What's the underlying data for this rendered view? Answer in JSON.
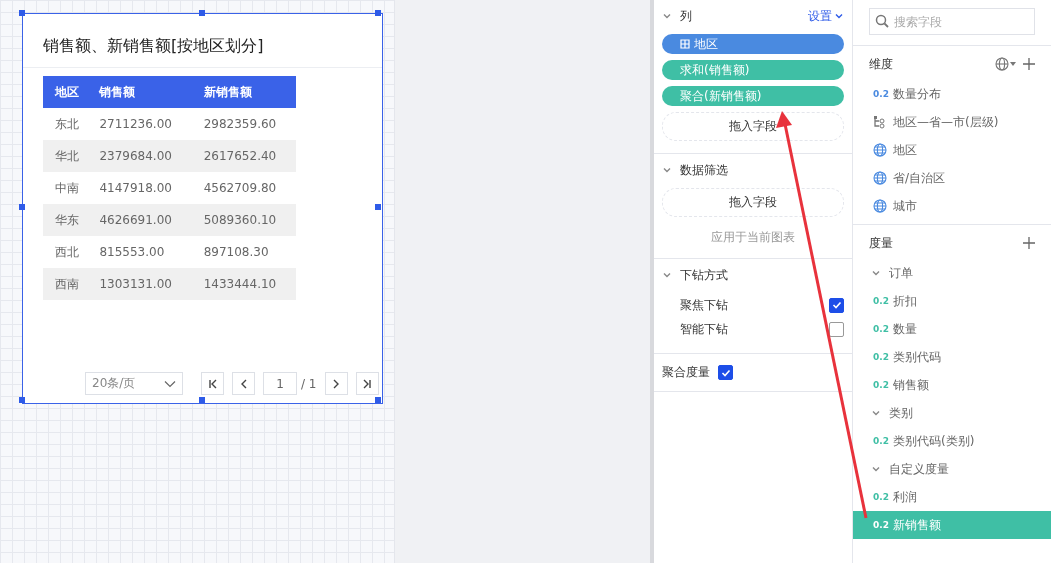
{
  "chart_card": {
    "title": "销售额、新销售额[按地区划分]",
    "table": {
      "columns": [
        "地区",
        "销售额",
        "新销售额"
      ],
      "rows": [
        [
          "东北",
          "2711236.00",
          "2982359.60"
        ],
        [
          "华北",
          "2379684.00",
          "2617652.40"
        ],
        [
          "中南",
          "4147918.00",
          "4562709.80"
        ],
        [
          "华东",
          "4626691.00",
          "5089360.10"
        ],
        [
          "西北",
          "815553.00",
          "897108.30"
        ],
        [
          "西南",
          "1303131.00",
          "1433444.10"
        ]
      ]
    },
    "pagination": {
      "page_size": "20条/页",
      "page": "1",
      "total": "/ 1"
    }
  },
  "config_panel": {
    "columns_section": {
      "title": "列",
      "action": "设置",
      "fields": [
        {
          "label": "地区",
          "kind": "dimension"
        },
        {
          "label": "求和(销售额)",
          "kind": "measure"
        },
        {
          "label": "聚合(新销售额)",
          "kind": "measure"
        }
      ],
      "drop_hint": "拖入字段"
    },
    "filter_section": {
      "title": "数据筛选",
      "drop_hint": "拖入字段",
      "note": "应用于当前图表"
    },
    "drill_section": {
      "title": "下钻方式",
      "options": [
        {
          "label": "聚焦下钻",
          "checked": true
        },
        {
          "label": "智能下钻",
          "checked": false
        }
      ]
    },
    "aggregate_measures": {
      "label": "聚合度量",
      "checked": true
    }
  },
  "field_panel": {
    "search": {
      "placeholder": "搜索字段"
    },
    "dimensions": {
      "title": "维度",
      "items": [
        {
          "kind": "number",
          "badge": "0.2",
          "label": "数量分布"
        },
        {
          "kind": "hierarchy",
          "label": "地区—省—市(层级)"
        },
        {
          "kind": "geo",
          "label": "地区"
        },
        {
          "kind": "geo",
          "label": "省/自治区"
        },
        {
          "kind": "geo",
          "label": "城市"
        }
      ]
    },
    "measures": {
      "title": "度量",
      "groups": [
        {
          "label": "订单",
          "expanded": true,
          "children": [
            {
              "badge": "0.2",
              "label": "折扣",
              "selected": false
            },
            {
              "badge": "0.2",
              "label": "数量",
              "selected": false
            },
            {
              "badge": "0.2",
              "label": "类别代码",
              "selected": false
            },
            {
              "badge": "0.2",
              "label": "销售额",
              "selected": false
            }
          ]
        },
        {
          "label": "类别",
          "expanded": true,
          "children": [
            {
              "badge": "0.2",
              "label": "类别代码(类别)",
              "selected": false
            }
          ]
        },
        {
          "label": "自定义度量",
          "expanded": true,
          "children": [
            {
              "badge": "0.2",
              "label": "利润",
              "selected": false
            },
            {
              "badge": "0.2",
              "label": "新销售额",
              "selected": true
            }
          ]
        }
      ]
    }
  }
}
